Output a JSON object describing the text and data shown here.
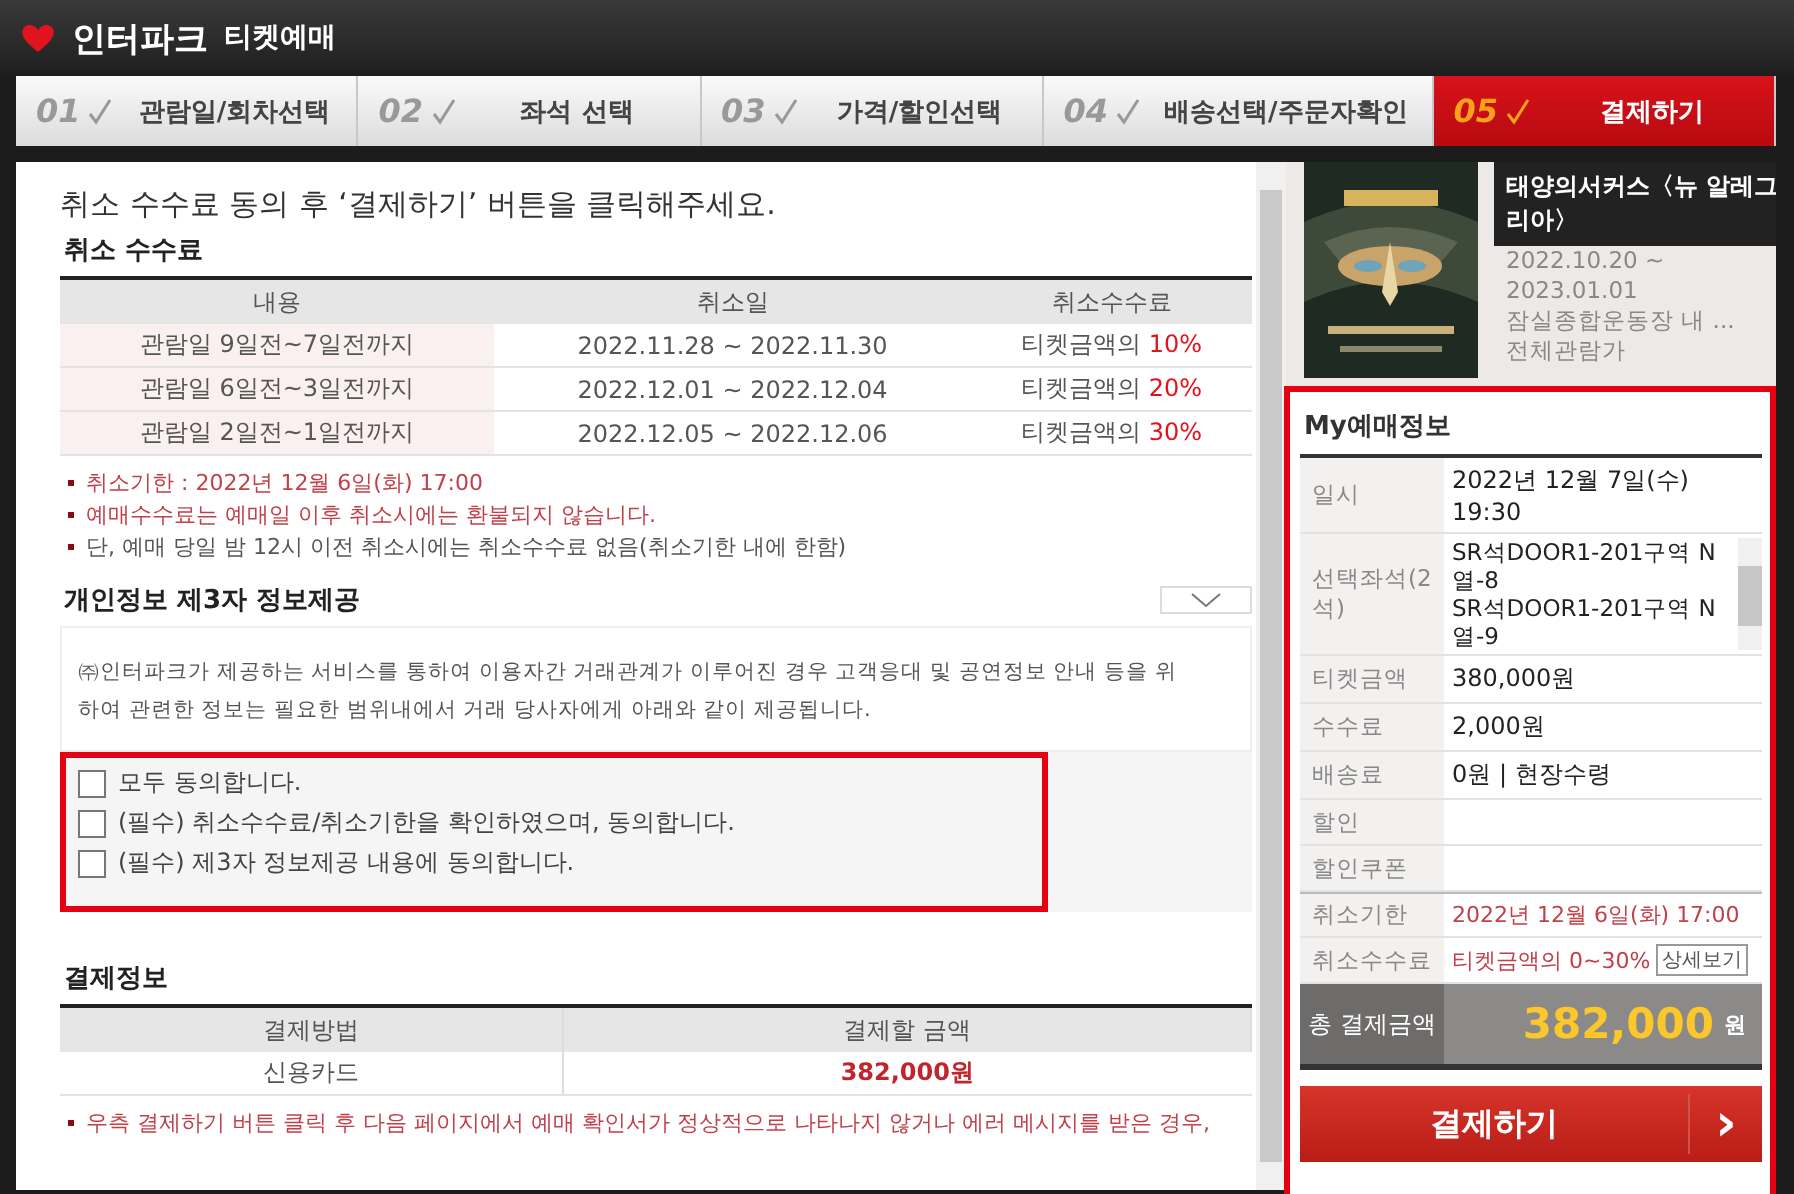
{
  "header": {
    "logo_text": "인터파크",
    "subtitle": "티켓예매"
  },
  "steps": [
    {
      "number": "01",
      "label": "관람일/회차선택",
      "selected": false
    },
    {
      "number": "02",
      "label": "좌석 선택",
      "selected": false
    },
    {
      "number": "03",
      "label": "가격/할인선택",
      "selected": false
    },
    {
      "number": "04",
      "label": "배송선택/주문자확인",
      "selected": false
    },
    {
      "number": "05",
      "label": "결제하기",
      "selected": true
    }
  ],
  "instruction": "취소 수수료 동의 후 ‘결제하기’ 버튼을 클릭해주세요.",
  "cancel_fee": {
    "title": "취소 수수료",
    "columns": [
      "내용",
      "취소일",
      "취소수수료"
    ],
    "rows": [
      {
        "period": "관람일 9일전~7일전까지",
        "dates": "2022.11.28 ~ 2022.11.30",
        "fee_prefix": "티켓금액의",
        "fee_rate": "10%"
      },
      {
        "period": "관람일 6일전~3일전까지",
        "dates": "2022.12.01 ~ 2022.12.04",
        "fee_prefix": "티켓금액의",
        "fee_rate": "20%"
      },
      {
        "period": "관람일 2일전~1일전까지",
        "dates": "2022.12.05 ~ 2022.12.06",
        "fee_prefix": "티켓금액의",
        "fee_rate": "30%"
      }
    ],
    "notes": [
      {
        "text": "취소기한 : 2022년 12월 6일(화) 17:00",
        "kind": "warning"
      },
      {
        "text": "예매수수료는 예매일 이후 취소시에는 환불되지 않습니다.",
        "kind": "warning"
      },
      {
        "text": "단, 예매 당일 밤 12시 이전 취소시에는 취소수수료 없음(취소기한 내에 한함)",
        "kind": "plain"
      }
    ]
  },
  "privacy": {
    "title": "개인정보 제3자 정보제공",
    "expanded": false,
    "text": "㈜인터파크가 제공하는 서비스를 통하여 이용자간 거래관계가 이루어진 경우 고객응대 및 공연정보 안내 등을 위하여 관련한 정보는 필요한 범위내에서 거래 당사자에게 아래와 같이 제공됩니다.",
    "agreements": [
      {
        "label": "모두 동의합니다.",
        "checked": false
      },
      {
        "label": "(필수) 취소수수료/취소기한을 확인하였으며, 동의합니다.",
        "checked": false
      },
      {
        "label": "(필수) 제3자 정보제공 내용에 동의합니다.",
        "checked": false
      }
    ]
  },
  "payment_info": {
    "title": "결제정보",
    "columns": [
      "결제방법",
      "결제할 금액"
    ],
    "method": "신용카드",
    "amount": "382,000원",
    "notes": [
      "우측 결제하기 버튼 클릭 후 다음 페이지에서 예매 확인서가 정상적으로 나타나지 않거나 에러 메시지를 받은 경우,"
    ]
  },
  "show": {
    "title": "태양의서커스〈뉴 알레그리아〉",
    "lines": [
      "2022.10.20 ~",
      "2023.01.01",
      "잠실종합운동장 내 ...",
      "전체관람가"
    ]
  },
  "my_booking": {
    "title": "My예매정보",
    "rows": [
      {
        "label": "일시",
        "kind": "plain",
        "values": [
          "2022년 12월 7일(수) 19:30"
        ]
      },
      {
        "label": "선택좌석(2석)",
        "kind": "seats",
        "values": [
          "SR석DOOR1-201구역 N열-8",
          "SR석DOOR1-201구역 N열-9"
        ]
      },
      {
        "label": "티켓금액",
        "kind": "plain",
        "values": [
          "380,000원"
        ]
      },
      {
        "label": "수수료",
        "kind": "plain",
        "values": [
          "2,000원"
        ]
      },
      {
        "label": "배송료",
        "kind": "plain",
        "values": [
          "0원 | 현장수령"
        ]
      },
      {
        "label": "할인",
        "kind": "plain",
        "values": []
      },
      {
        "label": "할인쿠폰",
        "kind": "plain",
        "values": []
      },
      {
        "label": "취소기한",
        "kind": "warning",
        "values": [
          "2022년 12월 6일(화) 17:00"
        ]
      },
      {
        "label": "취소수수료",
        "kind": "fee",
        "values": [
          "티켓금액의 0~30%"
        ],
        "button": "상세보기"
      }
    ],
    "total": {
      "label": "총 결제금액",
      "amount": "382,000",
      "unit": "원"
    },
    "pay_button": "결제하기",
    "pay_arrow": "›"
  }
}
